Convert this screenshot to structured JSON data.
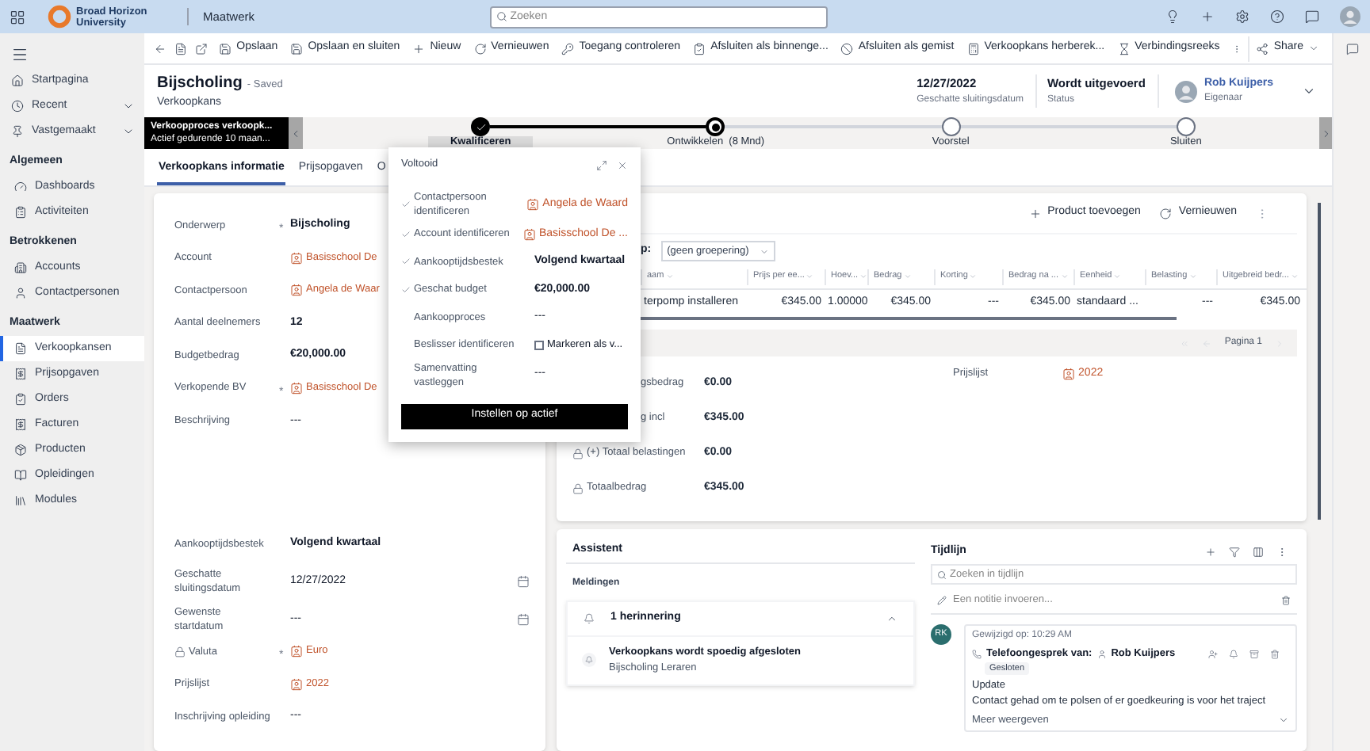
{
  "app": {
    "org_name": "Broad Horizon University",
    "area": "Maatwerk"
  },
  "search": {
    "placeholder": "Zoeken"
  },
  "sidebar": {
    "top_items": [
      {
        "label": "Startpagina",
        "expandable": false
      },
      {
        "label": "Recent",
        "expandable": true
      },
      {
        "label": "Vastgemaakt",
        "expandable": true
      }
    ],
    "groups": [
      {
        "title": "Algemeen",
        "items": [
          {
            "label": "Dashboards",
            "selected": false
          },
          {
            "label": "Activiteiten",
            "selected": false
          }
        ]
      },
      {
        "title": "Betrokkenen",
        "items": [
          {
            "label": "Accounts",
            "selected": false
          },
          {
            "label": "Contactpersonen",
            "selected": false
          }
        ]
      },
      {
        "title": "Maatwerk",
        "items": [
          {
            "label": "Verkoopkansen",
            "selected": true
          },
          {
            "label": "Prijsopgaven",
            "selected": false
          },
          {
            "label": "Orders",
            "selected": false
          },
          {
            "label": "Facturen",
            "selected": false
          },
          {
            "label": "Producten",
            "selected": false
          },
          {
            "label": "Opleidingen",
            "selected": false
          },
          {
            "label": "Modules",
            "selected": false
          }
        ]
      }
    ]
  },
  "commands": [
    "Opslaan",
    "Opslaan en sluiten",
    "Nieuw",
    "Vernieuwen",
    "Toegang controleren",
    "Afsluiten als binnenge...",
    "Afsluiten als gemist",
    "Verkoopkans herberek...",
    "Verbindingsreeks"
  ],
  "share": "Share",
  "record": {
    "title": "Bijscholing",
    "saved_status": "- Saved",
    "entity": "Verkoopkans",
    "header_fields": [
      {
        "value": "12/27/2022",
        "label": "Geschatte sluitingsdatum"
      },
      {
        "value": "Wordt uitgevoerd",
        "label": "Status"
      }
    ],
    "owner": {
      "name": "Rob Kuijpers",
      "role": "Eigenaar"
    }
  },
  "process": {
    "name": "Verkoopproces verkoopk...",
    "duration": "Actief gedurende 10 maan...",
    "stages": [
      {
        "label": "Kwalificeren",
        "kind": "done",
        "selected": true
      },
      {
        "label": "Ontwikkelen  (8 Mnd)",
        "kind": "active",
        "selected": false
      },
      {
        "label": "Voorstel",
        "kind": "pending",
        "selected": false
      },
      {
        "label": "Sluiten",
        "kind": "pending",
        "selected": false
      }
    ]
  },
  "tabs": [
    {
      "label": "Verkoopkans informatie",
      "selected": true
    },
    {
      "label": "Prijsopgaven",
      "selected": false
    },
    {
      "label": "O",
      "selected": false
    }
  ],
  "form": {
    "fields": [
      {
        "label": "Onderwerp",
        "required_mark": "*",
        "locked": false,
        "kind": "text",
        "value": "Bijscholing"
      },
      {
        "label": "Account",
        "locked": false,
        "kind": "lookup",
        "value": "Basisschool De"
      },
      {
        "label": "Contactpersoon",
        "locked": false,
        "kind": "lookup",
        "value": "Angela de Waar"
      },
      {
        "label": "Aantal deelnemers",
        "locked": false,
        "kind": "text",
        "value": "12"
      },
      {
        "label": "Budgetbedrag",
        "locked": false,
        "kind": "text",
        "value": "€20,000.00"
      },
      {
        "label": "Verkopende BV",
        "required_mark": "*",
        "locked": false,
        "kind": "lookup",
        "value": "Basisschool De"
      },
      {
        "label": "Beschrijving",
        "locked": false,
        "kind": "multiline",
        "value": "---"
      },
      {
        "label": "Aankooptijdsbestek",
        "locked": false,
        "kind": "text",
        "value": "Volgend kwartaal"
      },
      {
        "label": "Geschatte sluitingsdatum",
        "locked": false,
        "kind": "date",
        "value": "12/27/2022"
      },
      {
        "label": "Gewenste startdatum",
        "locked": false,
        "kind": "date",
        "value": "---"
      },
      {
        "label": "Valuta",
        "required_mark": "*",
        "locked": true,
        "kind": "lookup",
        "value": "Euro"
      },
      {
        "label": "Prijslijst",
        "locked": false,
        "kind": "lookup",
        "value": "2022"
      },
      {
        "label": "Inschrijving opleiding",
        "locked": false,
        "kind": "empty",
        "value": "---"
      }
    ]
  },
  "flyout": {
    "title": "Voltooid",
    "button": "Instellen op actief",
    "steps": [
      {
        "label": "Contactpersoon identificeren",
        "done": true,
        "kind": "lookup",
        "value": "Angela de Waard"
      },
      {
        "label": "Account identificeren",
        "done": true,
        "kind": "lookup",
        "value": "Basisschool De ..."
      },
      {
        "label": "Aankooptijdsbestek",
        "done": true,
        "kind": "text",
        "value": "Volgend kwartaal"
      },
      {
        "label": "Geschat budget",
        "done": true,
        "kind": "text",
        "value": "€20,000.00"
      },
      {
        "label": "Aankoopproces",
        "done": false,
        "kind": "empty",
        "value": "---"
      },
      {
        "label": "Beslisser identificeren",
        "done": false,
        "kind": "checkbox",
        "value": "Markeren als v...",
        "checked": false
      },
      {
        "label": "Samenvatting vastleggen",
        "done": false,
        "kind": "empty",
        "value": "---"
      }
    ]
  },
  "products": {
    "toolbar": [
      "Product toevoegen",
      "Vernieuwen"
    ],
    "group_label": "p:",
    "group_by": "(geen groepering)",
    "columns": [
      "aam",
      "Prijs per ee...",
      "Hoev...",
      "Bedrag",
      "Korting",
      "Bedrag na ...",
      "Eenheid",
      "Belasting",
      "Uitgebreid bedr..."
    ],
    "rows": [
      [
        "terpomp installeren",
        "€345.00",
        "1.00000",
        "€345.00",
        "---",
        "€345.00",
        "standaard ...",
        "---",
        "€345.00"
      ]
    ],
    "pager": "Pagina 1",
    "summary": [
      {
        "label": "gsbedrag",
        "value": "€0.00",
        "locked": false
      },
      {
        "label": "g incl",
        "value": "€345.00",
        "locked": false
      },
      {
        "label": "(+) Totaal belastingen",
        "value": "€0.00",
        "locked": true
      },
      {
        "label": "Totaalbedrag",
        "value": "€345.00",
        "locked": true
      }
    ],
    "side_field": {
      "label": "Prijslijst",
      "value": "2022"
    }
  },
  "assistant": {
    "title": "Assistent",
    "section": "Meldingen",
    "group": "1 herinnering",
    "expanded": true,
    "items": [
      {
        "title": "Verkoopkans wordt spoedig afgesloten",
        "subtitle": "Bijscholing Leraren"
      }
    ]
  },
  "timeline": {
    "title": "Tijdlijn",
    "search_placeholder": "Zoeken in tijdlijn",
    "note_placeholder": "Een notitie invoeren...",
    "entries": [
      {
        "initials": "RK",
        "modified": "Gewijzigd op: 10:29 AM",
        "type": "Telefoongesprek van:",
        "who": "Rob Kuijpers",
        "badge": "Gesloten",
        "subject": "Update",
        "body": "Contact gehad om te polsen of er goedkeuring is voor het traject",
        "more": "Meer weergeven"
      }
    ]
  }
}
